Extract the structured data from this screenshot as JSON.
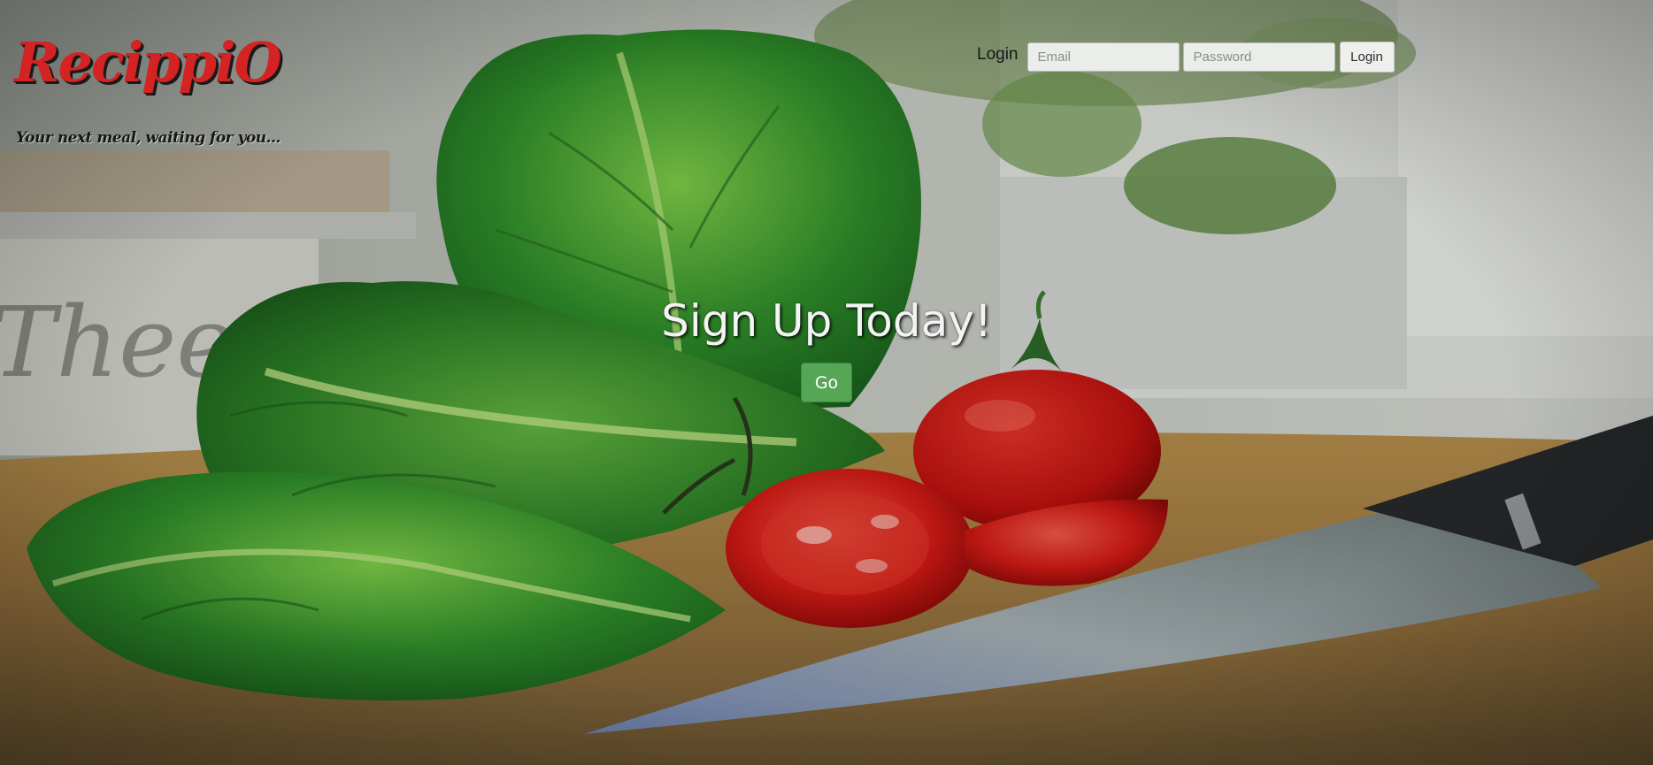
{
  "brand": {
    "logo_text": "RecippiO",
    "tagline": "Your next meal, waiting for you..."
  },
  "login": {
    "title": "Login",
    "email_placeholder": "Email",
    "password_placeholder": "Password",
    "submit_label": "Login"
  },
  "hero": {
    "title": "Sign Up Today!",
    "cta_label": "Go"
  },
  "colors": {
    "logo_red": "#d42323",
    "cta_green": "#55a655"
  },
  "background": {
    "subject": "kitchen-photo-lettuce-tomatoes-knife"
  }
}
